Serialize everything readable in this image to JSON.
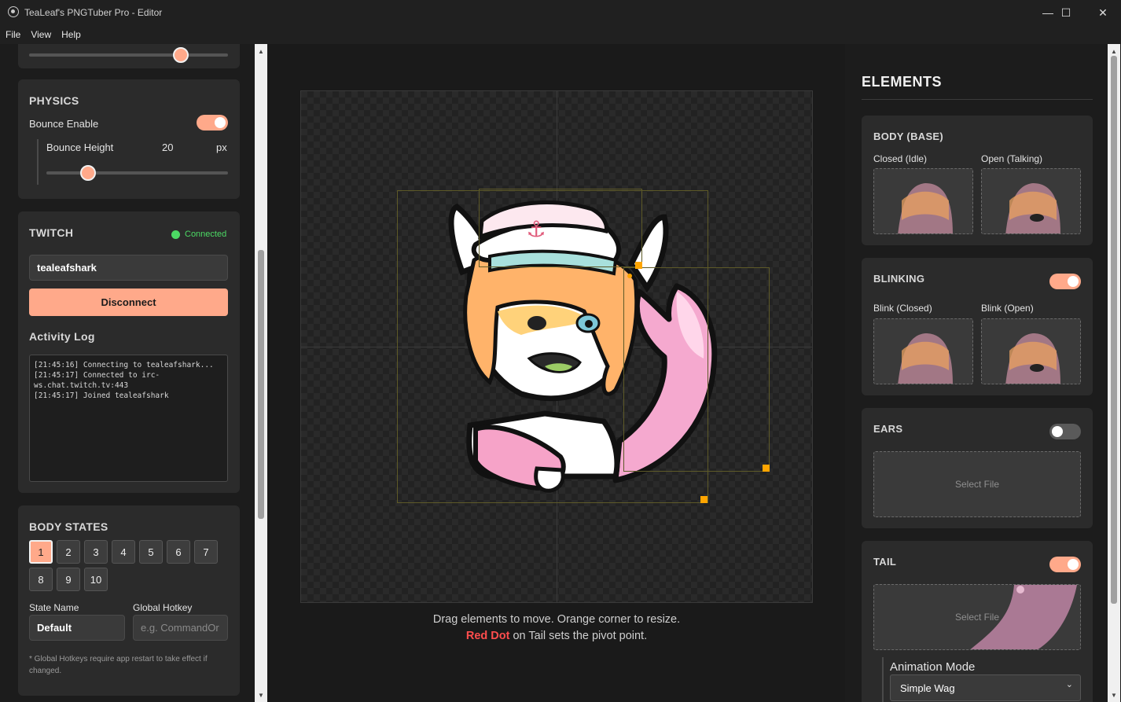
{
  "window": {
    "title": "TeaLeaf's PNGTuber Pro - Editor",
    "minimize_glyph": "—",
    "maximize_glyph": "☐",
    "close_glyph": "✕"
  },
  "menu": [
    "File",
    "View",
    "Help"
  ],
  "physics": {
    "title": "PHYSICS",
    "bounce_enable_label": "Bounce Enable",
    "bounce_enable": true,
    "bounce_height_label": "Bounce Height",
    "bounce_height_value": "20",
    "bounce_height_unit": "px"
  },
  "twitch": {
    "title": "TWITCH",
    "status": "Connected",
    "status_color": "#4cd964",
    "channel_value": "tealeafshark",
    "disconnect_label": "Disconnect",
    "activity_log_title": "Activity Log",
    "log_lines": [
      "[21:45:16] Connecting to tealeafshark...",
      "[21:45:17] Connected to irc-ws.chat.twitch.tv:443",
      "[21:45:17] Joined tealeafshark"
    ]
  },
  "body_states": {
    "title": "BODY STATES",
    "states": [
      "1",
      "2",
      "3",
      "4",
      "5",
      "6",
      "7",
      "8",
      "9",
      "10"
    ],
    "active_state": "1",
    "state_name_label": "State Name",
    "state_name_value": "Default",
    "global_hotkey_label": "Global Hotkey",
    "global_hotkey_placeholder": "e.g. CommandOr",
    "note": "* Global Hotkeys require app restart to take effect if changed."
  },
  "canvas": {
    "hint_line1": "Drag elements to move. Orange corner to resize.",
    "hint_red": "Red Dot",
    "hint_line2_rest": " on Tail sets the pivot point."
  },
  "elements": {
    "heading": "ELEMENTS",
    "body_base": {
      "title": "BODY (BASE)",
      "closed_label": "Closed (Idle)",
      "open_label": "Open (Talking)"
    },
    "blinking": {
      "title": "BLINKING",
      "enabled": true,
      "closed_label": "Blink (Closed)",
      "open_label": "Blink (Open)"
    },
    "ears": {
      "title": "EARS",
      "enabled": false,
      "select_file": "Select File"
    },
    "tail": {
      "title": "TAIL",
      "enabled": true,
      "select_file": "Select File",
      "animation_mode_label": "Animation Mode",
      "animation_mode_value": "Simple Wag"
    }
  },
  "colors": {
    "accent": "#ffa98a",
    "background": "#1c1c1c",
    "card": "#2b2b2b",
    "handle": "#ffa500"
  }
}
